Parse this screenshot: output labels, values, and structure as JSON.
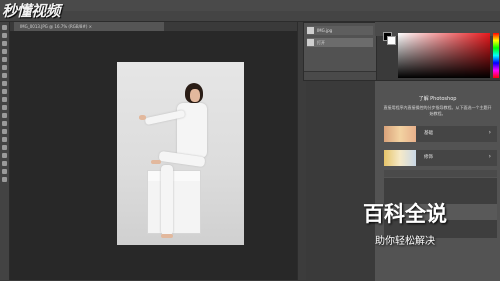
{
  "watermark": {
    "logo": "秒懂视频",
    "main": "百科全说",
    "sub": "助你轻松解决"
  },
  "document": {
    "tab": "IMG_0013.JPG @ 16.7% (RGB/8#) ×"
  },
  "history": {
    "items": [
      {
        "label": "IMG.jpg"
      },
      {
        "label": "打开"
      }
    ]
  },
  "colors": {
    "foreground": "#000000",
    "background": "#ffffff",
    "accent": "#e8191d"
  },
  "learn": {
    "title": "了解 Photoshop",
    "description": "直接用程序内直接操控的分步指导教程。从下面选一个主题开始教程。",
    "cards": [
      {
        "label": "基础",
        "arrow": "›"
      },
      {
        "label": "修饰",
        "arrow": "›"
      }
    ]
  }
}
